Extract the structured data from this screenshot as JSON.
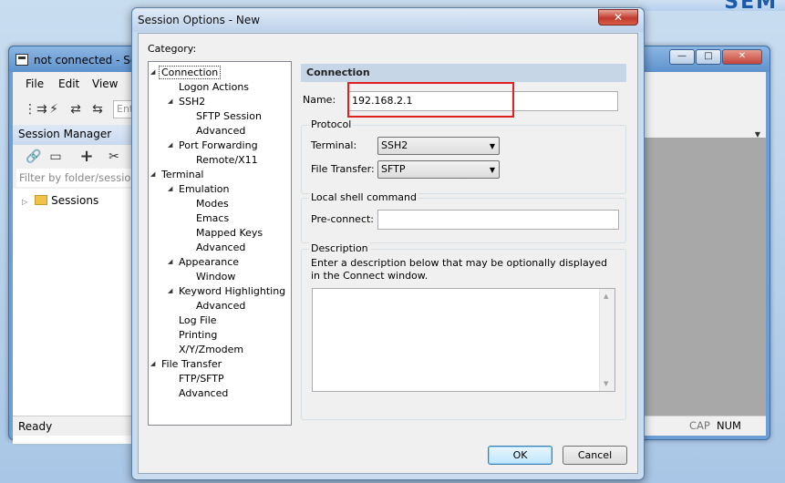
{
  "brand": {
    "text": "SEM"
  },
  "main_window": {
    "title": "not connected - Se",
    "buttons": {
      "minimize": "—",
      "maximize": "□",
      "close": "✕"
    },
    "menu": [
      "File",
      "Edit",
      "View"
    ],
    "toolbar": {
      "icons": [
        "connect-tree-icon",
        "quick-connect-icon",
        "reconnect-icon",
        "disconnect-icon"
      ],
      "input_placeholder": "Ent"
    },
    "session_manager": {
      "title": "Session Manager",
      "icons": [
        "link-icon",
        "new-window-icon",
        "add-icon",
        "cut-icon"
      ],
      "filter_placeholder": "Filter by folder/session",
      "sessions_label": "Sessions"
    },
    "status": {
      "ready": "Ready",
      "cap": "CAP",
      "num": "NUM"
    }
  },
  "dialog": {
    "title": "Session Options - New",
    "close_label": "✕",
    "category_label": "Category:",
    "tree": [
      {
        "label": "Connection",
        "level": 0,
        "expander": "◢",
        "selected": true
      },
      {
        "label": "Logon Actions",
        "level": 1
      },
      {
        "label": "SSH2",
        "level": 1,
        "expander": "◢"
      },
      {
        "label": "SFTP Session",
        "level": 2
      },
      {
        "label": "Advanced",
        "level": 2
      },
      {
        "label": "Port Forwarding",
        "level": 1,
        "expander": "◢"
      },
      {
        "label": "Remote/X11",
        "level": 2
      },
      {
        "label": "Terminal",
        "level": 0,
        "expander": "◢"
      },
      {
        "label": "Emulation",
        "level": 1,
        "expander": "◢"
      },
      {
        "label": "Modes",
        "level": 2
      },
      {
        "label": "Emacs",
        "level": 2
      },
      {
        "label": "Mapped Keys",
        "level": 2
      },
      {
        "label": "Advanced",
        "level": 2
      },
      {
        "label": "Appearance",
        "level": 1,
        "expander": "◢"
      },
      {
        "label": "Window",
        "level": 2
      },
      {
        "label": "Keyword Highlighting",
        "level": 1,
        "expander": "◢"
      },
      {
        "label": "Advanced",
        "level": 2
      },
      {
        "label": "Log File",
        "level": 1
      },
      {
        "label": "Printing",
        "level": 1
      },
      {
        "label": "X/Y/Zmodem",
        "level": 1
      },
      {
        "label": "File Transfer",
        "level": 0,
        "expander": "◢"
      },
      {
        "label": "FTP/SFTP",
        "level": 1
      },
      {
        "label": "Advanced",
        "level": 1
      }
    ],
    "panel": {
      "header": "Connection",
      "name_label": "Name:",
      "name_value": "192.168.2.1",
      "protocol": {
        "title": "Protocol",
        "terminal_label": "Terminal:",
        "terminal_value": "SSH2",
        "file_transfer_label": "File Transfer:",
        "file_transfer_value": "SFTP"
      },
      "local_shell": {
        "title": "Local shell command",
        "preconnect_label": "Pre-connect:",
        "preconnect_value": ""
      },
      "description": {
        "title": "Description",
        "hint": "Enter a description below that may be optionally displayed in the Connect window.",
        "value": ""
      }
    },
    "buttons": {
      "ok": "OK",
      "cancel": "Cancel"
    },
    "highlight_color": "#e02020"
  }
}
